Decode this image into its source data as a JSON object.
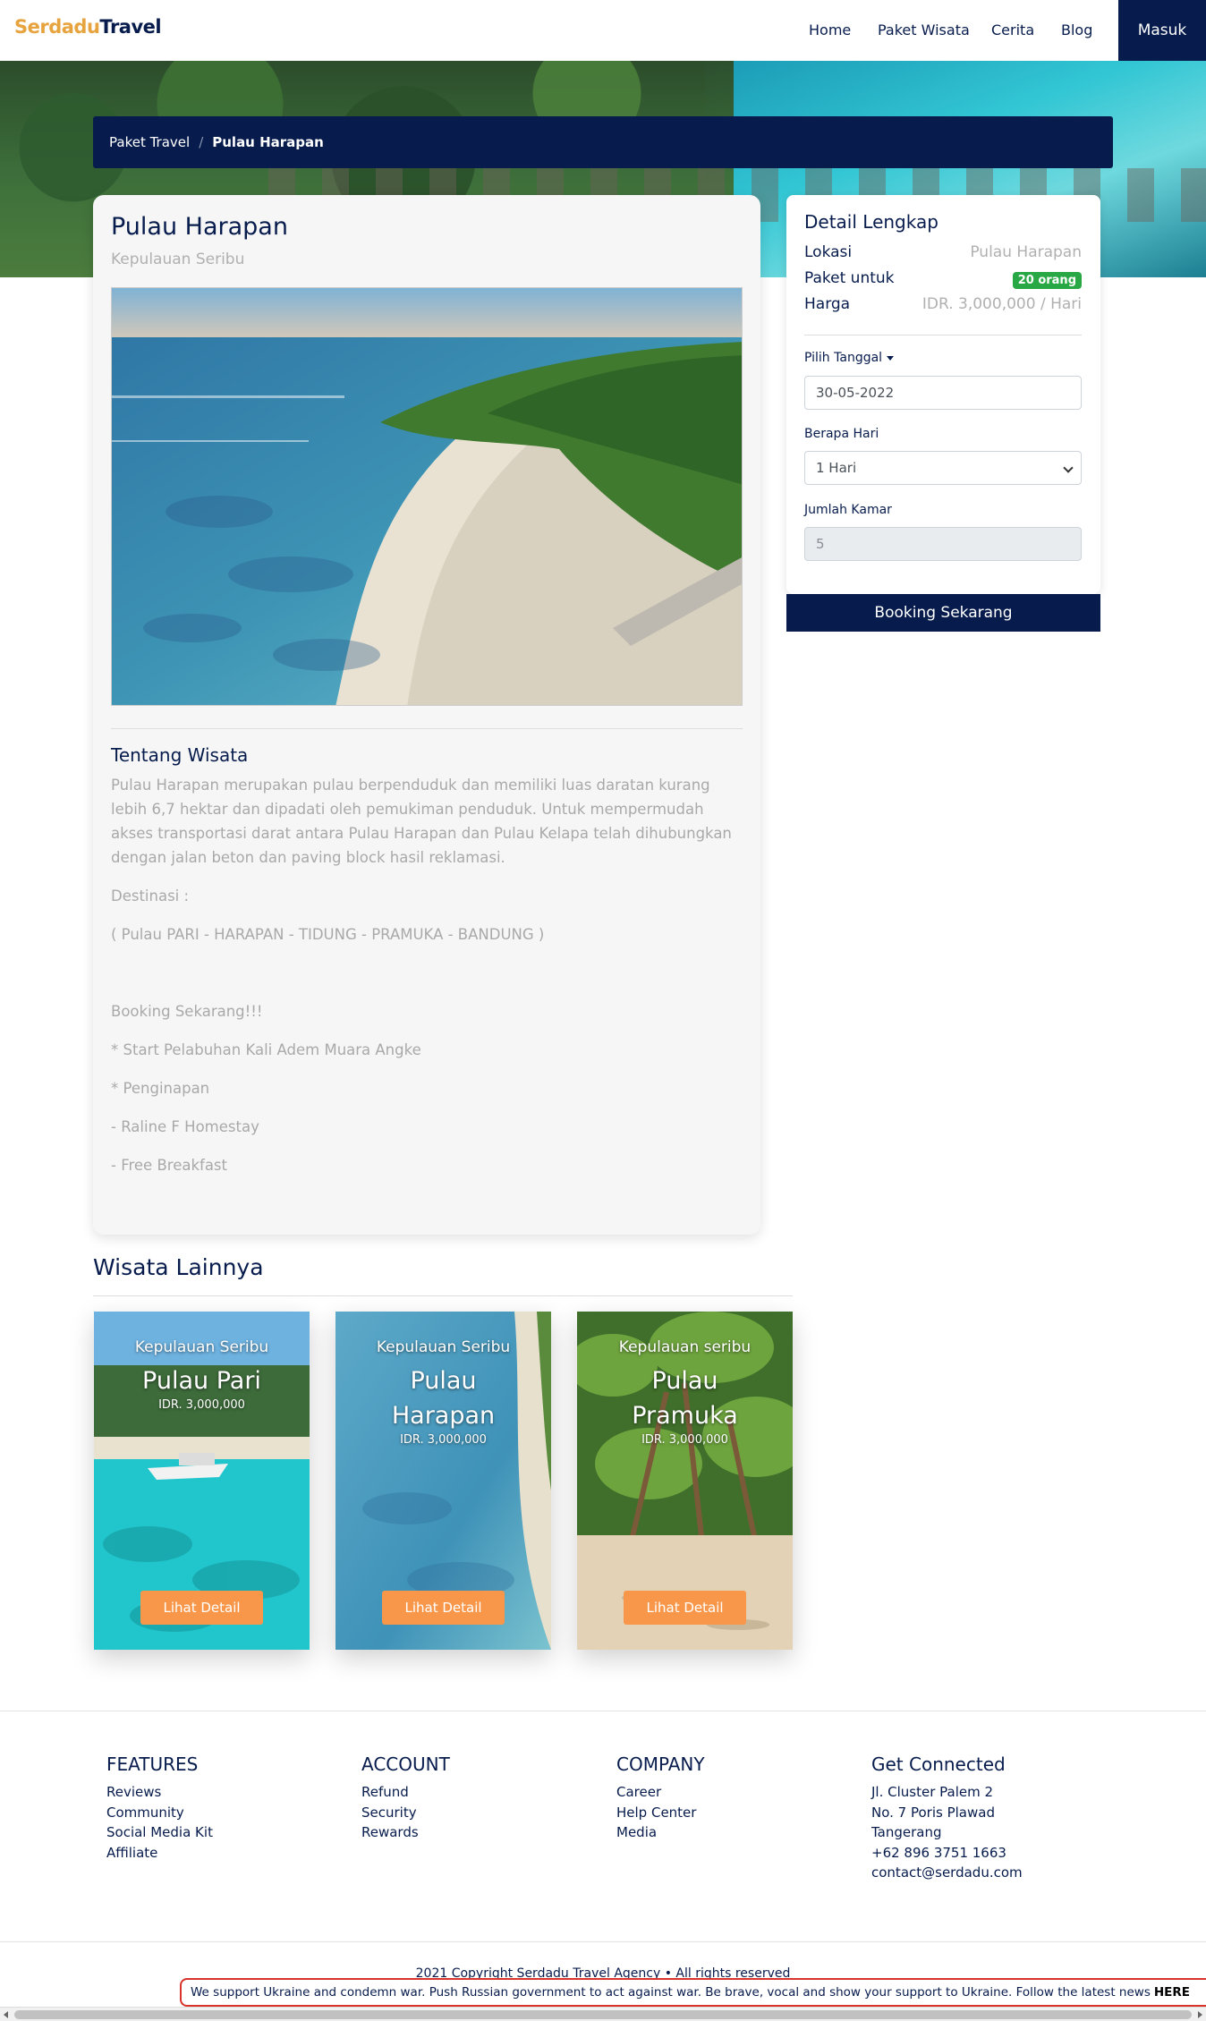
{
  "navbar": {
    "brand_part1": "Serdadu",
    "brand_part2": "Travel",
    "links": [
      "Home",
      "Paket Wisata",
      "Cerita",
      "Blog"
    ],
    "login_label": "Masuk"
  },
  "breadcrumb": {
    "parent": "Paket Travel",
    "separator": "/",
    "current": "Pulau Harapan"
  },
  "trip": {
    "title": "Pulau Harapan",
    "location": "Kepulauan Seribu",
    "about_title": "Tentang Wisata",
    "about_paragraphs": [
      "Pulau Harapan merupakan pulau berpenduduk dan memiliki luas daratan kurang lebih 6,7 hektar dan dipadati oleh pemukiman penduduk. Untuk mempermudah akses transportasi darat antara Pulau Harapan dan Pulau Kelapa telah dihubungkan dengan jalan beton dan paving block hasil reklamasi.",
      "Destinasi :",
      "( Pulau PARI - HARAPAN - TIDUNG - PRAMUKA - BANDUNG )",
      "",
      "Booking Sekarang!!!",
      "* Start Pelabuhan Kali Adem Muara Angke",
      "* Penginapan",
      "- Raline F Homestay",
      "- Free Breakfast"
    ]
  },
  "details": {
    "title": "Detail Lengkap",
    "location_label": "Lokasi",
    "location_value": "Pulau Harapan",
    "package_label": "Paket untuk",
    "package_badge": "20 orang",
    "price_label": "Harga",
    "price_value": "IDR. 3,000,000 / Hari",
    "date_label": "Pilih Tanggal",
    "date_value": "30-05-2022",
    "days_label": "Berapa Hari",
    "days_value": "1 Hari",
    "rooms_label": "Jumlah Kamar",
    "rooms_value": "5",
    "book_label": "Booking Sekarang"
  },
  "others": {
    "title": "Wisata Lainnya",
    "cards": [
      {
        "location": "Kepulauan Seribu",
        "name": "Pulau Pari",
        "price": "IDR. 3,000,000",
        "button": "Lihat Detail"
      },
      {
        "location": "Kepulauan Seribu",
        "name": "Pulau Harapan",
        "price": "IDR. 3,000,000",
        "button": "Lihat Detail"
      },
      {
        "location": "Kepulauan seribu",
        "name": "Pulau Pramuka",
        "price": "IDR. 3,000,000",
        "button": "Lihat Detail"
      }
    ]
  },
  "footer": {
    "columns": [
      {
        "title": "FEATURES",
        "items": [
          "Reviews",
          "Community",
          "Social Media Kit",
          "Affiliate"
        ]
      },
      {
        "title": "ACCOUNT",
        "items": [
          "Refund",
          "Security",
          "Rewards"
        ]
      },
      {
        "title": "COMPANY",
        "items": [
          "Career",
          "Help Center",
          "Media"
        ]
      },
      {
        "title": "Get Connected",
        "items": [
          "Jl. Cluster Palem 2",
          "No. 7 Poris Plawad",
          "Tangerang",
          "+62 896 3751 1663",
          "contact@serdadu.com"
        ]
      }
    ],
    "copyright": "2021 Copyright Serdadu Travel Agency • All rights reserved"
  },
  "ukraine_banner": {
    "text": "We support Ukraine and condemn war. Push Russian government to act against war. Be brave, vocal and show your support to Ukraine. Follow the latest news",
    "link": "HERE"
  },
  "colors": {
    "primary": "#071C4D",
    "accent": "#F8974A",
    "brand_orange": "#E7A33E",
    "badge_green": "#28a745"
  }
}
